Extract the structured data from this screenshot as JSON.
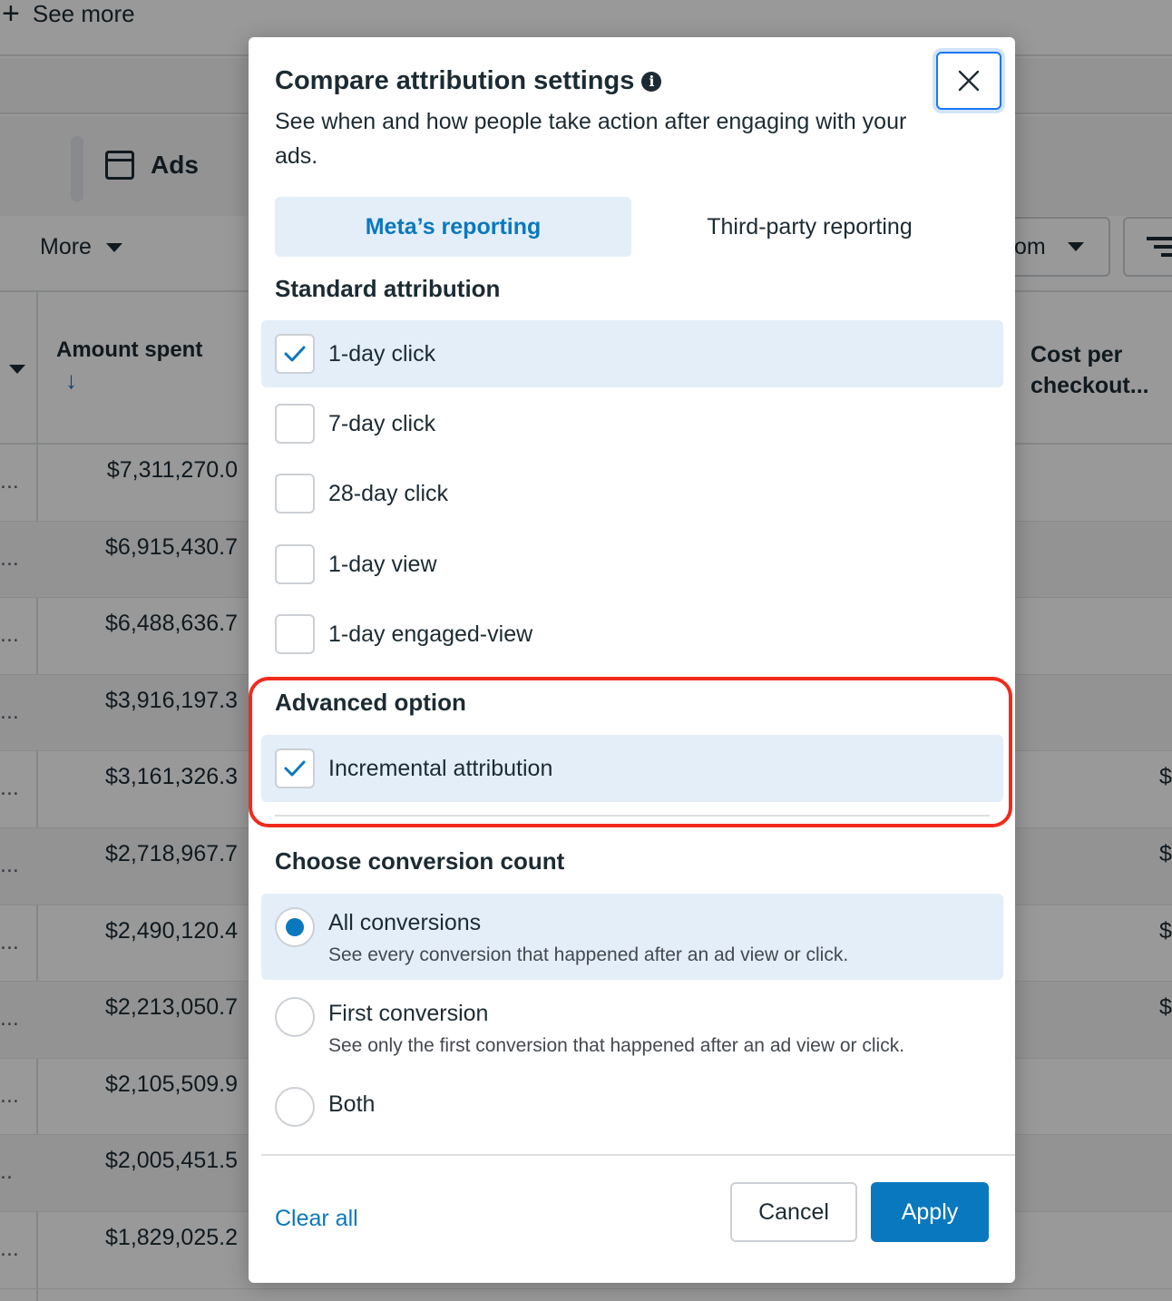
{
  "background": {
    "see_more": "See more",
    "tab_ads": "Ads",
    "more": "More",
    "custom_partial": "om",
    "amount_spent_header": "Amount spent",
    "cost_per_header_line1": "Cost per",
    "cost_per_header_line2": "checkout...",
    "rows": [
      {
        "dots": "...",
        "amount": "$7,311,270.0",
        "right": ""
      },
      {
        "dots": "...",
        "amount": "$6,915,430.7",
        "right": ""
      },
      {
        "dots": "...",
        "amount": "$6,488,636.7",
        "right": ""
      },
      {
        "dots": "...",
        "amount": "$3,916,197.3",
        "right": ""
      },
      {
        "dots": "...",
        "amount": "$3,161,326.3",
        "right": "$"
      },
      {
        "dots": "...",
        "amount": "$2,718,967.7",
        "right": "$"
      },
      {
        "dots": "...",
        "amount": "$2,490,120.4",
        "right": "$"
      },
      {
        "dots": "...",
        "amount": "$2,213,050.7",
        "right": "$"
      },
      {
        "dots": "...",
        "amount": "$2,105,509.9",
        "right": ""
      },
      {
        "dots": "..",
        "amount": "$2,005,451.5",
        "right": ""
      },
      {
        "dots": "...",
        "amount": "$1,829,025.2",
        "right": ""
      }
    ]
  },
  "dialog": {
    "title": "Compare attribution settings",
    "subtitle": "See when and how people take action after engaging with your ads.",
    "tabs": [
      {
        "label": "Meta’s reporting",
        "active": true
      },
      {
        "label": "Third-party reporting",
        "active": false
      }
    ],
    "standard_heading": "Standard attribution",
    "standard_options": [
      {
        "label": "1-day click",
        "checked": true
      },
      {
        "label": "7-day click",
        "checked": false
      },
      {
        "label": "28-day click",
        "checked": false
      },
      {
        "label": "1-day view",
        "checked": false
      },
      {
        "label": "1-day engaged-view",
        "checked": false
      }
    ],
    "advanced_heading": "Advanced option",
    "advanced_options": [
      {
        "label": "Incremental attribution",
        "checked": true
      }
    ],
    "conversion_heading": "Choose conversion count",
    "conversion_options": [
      {
        "title": "All conversions",
        "desc": "See every conversion that happened after an ad view or click.",
        "selected": true
      },
      {
        "title": "First conversion",
        "desc": "See only the first conversion that happened after an ad view or click.",
        "selected": false
      },
      {
        "title": "Both",
        "desc": "",
        "selected": false
      }
    ],
    "clear_all": "Clear all",
    "cancel": "Cancel",
    "apply": "Apply"
  },
  "colors": {
    "accent": "#0a78be",
    "selected_bg": "#e3eef9",
    "highlight_ring": "#f02b1d"
  }
}
